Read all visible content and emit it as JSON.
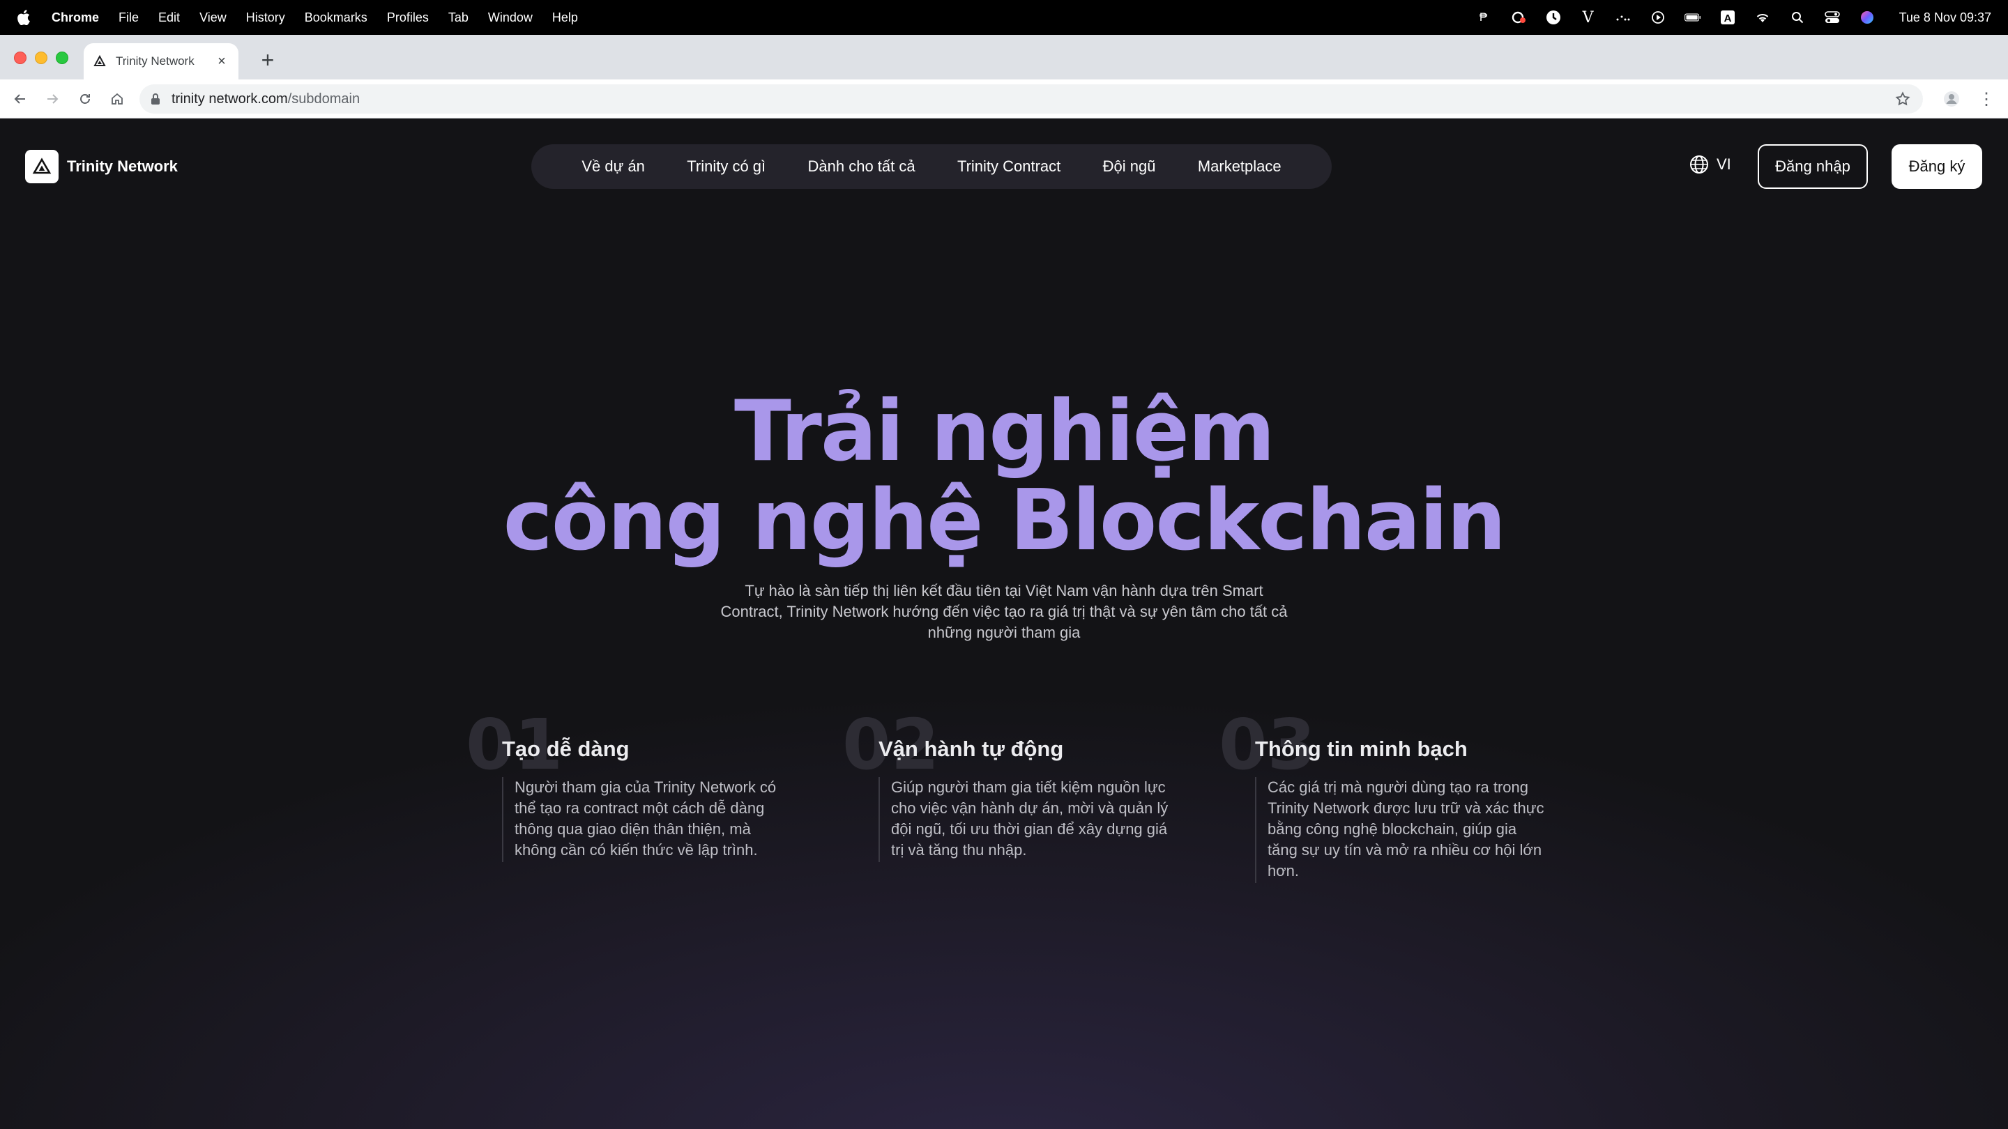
{
  "menubar": {
    "app": "Chrome",
    "items": [
      "File",
      "Edit",
      "View",
      "History",
      "Bookmarks",
      "Profiles",
      "Tab",
      "Window",
      "Help"
    ],
    "clock": "Tue 8 Nov  09:37"
  },
  "browser": {
    "tab_title": "Trinity Network",
    "url_host": "trinity network.com",
    "url_path": "/subdomain"
  },
  "site": {
    "logo_text": "Trinity Network",
    "nav": [
      "Về dự án",
      "Trinity có gì",
      "Dành cho tất cả",
      "Trinity Contract",
      "Đội ngũ",
      "Marketplace"
    ],
    "language": "VI",
    "login": "Đăng nhập",
    "signup": "Đăng ký"
  },
  "hero": {
    "title_line1": "Trải nghiệm",
    "title_line2": "công nghệ Blockchain",
    "subtitle": "Tự hào là sàn tiếp thị liên kết đầu tiên tại Việt Nam vận hành dựa trên Smart Contract, Trinity Network hướng đến việc tạo ra giá trị thật và sự yên tâm cho tất cả những người tham gia",
    "accent": "#a997ea"
  },
  "features": [
    {
      "number": "01",
      "title": "Tạo dễ dàng",
      "description": "Người tham gia của Trinity Network có thể tạo ra contract một cách dễ dàng thông qua giao diện thân thiện, mà không cần có kiến thức về lập trình."
    },
    {
      "number": "02",
      "title": "Vận hành tự động",
      "description": "Giúp người tham gia tiết kiệm nguồn lực cho việc vận hành dự án, mời và quản lý đội ngũ, tối ưu thời gian để xây dựng giá trị và tăng thu nhập."
    },
    {
      "number": "03",
      "title": "Thông tin minh bạch",
      "description": "Các giá trị mà người dùng tạo ra trong Trinity Network được lưu trữ và xác thực bằng công nghệ blockchain, giúp gia tăng sự uy tín và mở ra nhiều cơ hội lớn hơn."
    }
  ]
}
